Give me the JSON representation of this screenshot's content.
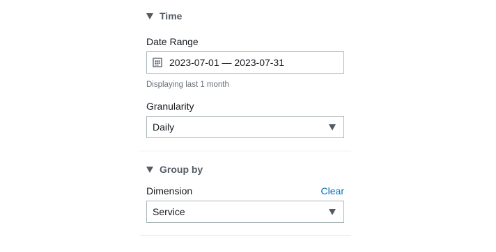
{
  "time_section": {
    "title": "Time",
    "date_range": {
      "label": "Date Range",
      "value": "2023-07-01 — 2023-07-31",
      "hint": "Displaying last 1 month"
    },
    "granularity": {
      "label": "Granularity",
      "value": "Daily"
    }
  },
  "group_by_section": {
    "title": "Group by",
    "dimension": {
      "label": "Dimension",
      "clear_label": "Clear",
      "value": "Service"
    }
  },
  "colors": {
    "link": "#0073bb",
    "border": "#aab7b8",
    "header_text": "#545b64",
    "hint_text": "#687078",
    "divider": "#eaeded"
  },
  "icons": {
    "date_range": "calendar-icon",
    "section_toggle": "caret-down-icon",
    "select": "caret-down-icon"
  }
}
